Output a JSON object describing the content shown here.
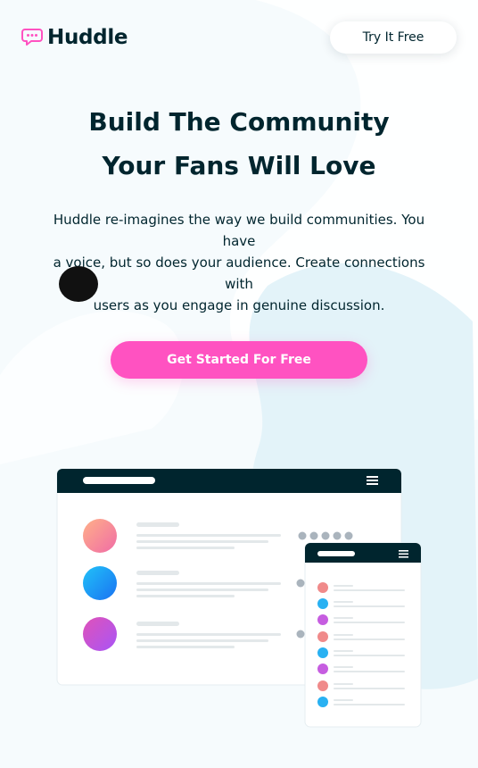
{
  "brand": {
    "name": "Huddle",
    "accent": "#ff52c1",
    "dark": "#00252e",
    "logo_icon": "chat-bubble-icon"
  },
  "header": {
    "cta_label": "Try It Free"
  },
  "hero": {
    "title_line1": "Build The Community",
    "title_line2": "Your Fans Will Love",
    "desc_line1": "Huddle re-imagines the way we build communities. You",
    "desc_line2": "have",
    "desc_line3": "a voice, but so does your audience. Create connections",
    "desc_line4": "with",
    "desc_line5": "users as you engage in genuine discussion.",
    "cta_label": "Get Started For Free"
  },
  "illustration": {
    "avatar_colors": [
      "#f08a8a",
      "#29b1f2",
      "#c65de0"
    ],
    "mobile_avatar_colors": [
      "#f08a8a",
      "#29b1f2",
      "#c65de0",
      "#f08a8a",
      "#29b1f2",
      "#c65de0",
      "#f08a8a",
      "#29b1f2"
    ]
  }
}
